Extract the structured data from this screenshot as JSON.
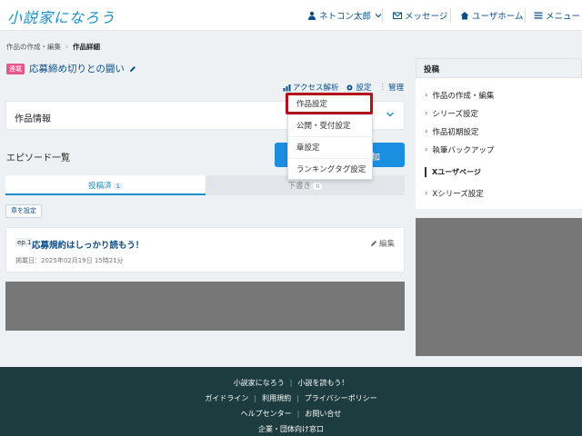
{
  "header": {
    "logo": "小説家になろう",
    "user": "ネトコン太郎",
    "messages": "メッセージ",
    "user_home": "ユーザホーム",
    "menu": "メニュー"
  },
  "breadcrumb": [
    "作品の作成・編集",
    "作品詳細"
  ],
  "work": {
    "badge": "連載",
    "title": "応募締め切りとの闘い"
  },
  "actions": {
    "access": "アクセス解析",
    "settings": "設定",
    "manage": "管理"
  },
  "dropdown": [
    "作品設定",
    "公開・受付設定",
    "章設定",
    "ランキングタグ設定"
  ],
  "info": {
    "label": "作品情報"
  },
  "episodes": {
    "heading": "エピソード一覧",
    "add_label": "加",
    "tabs": [
      {
        "label": "投稿済",
        "count": "1"
      },
      {
        "label": "下書き",
        "count": "0"
      }
    ],
    "chapter_button": "章を設定",
    "items": [
      {
        "no": "ep.1",
        "title": "応募規約はしっかり読もう！",
        "edit": "編集",
        "date": "掲載日：2025年02月19日 15時21分"
      }
    ]
  },
  "sidebar": {
    "heading": "投稿",
    "items": [
      "作品の作成・編集",
      "シリーズ設定",
      "作品初期設定",
      "執筆バックアップ"
    ],
    "x_heading": "Xユーザページ",
    "x_items": [
      "Xシリーズ設定"
    ]
  },
  "footer": {
    "row1": [
      "小説家になろう",
      "小説を読もう！"
    ],
    "row2": [
      "ガイドライン",
      "利用規約",
      "プライバシーポリシー"
    ],
    "row3": [
      "ヘルプセンター",
      "お問い合せ"
    ],
    "row4": [
      "企業・団体向け窓口"
    ]
  },
  "colors": {
    "accent": "#1a8ec8",
    "link": "#0b4f8a",
    "badge": "#e8558a",
    "button": "#1a8ee0",
    "highlight": "#b4101c",
    "footer": "#1c3c3f"
  }
}
